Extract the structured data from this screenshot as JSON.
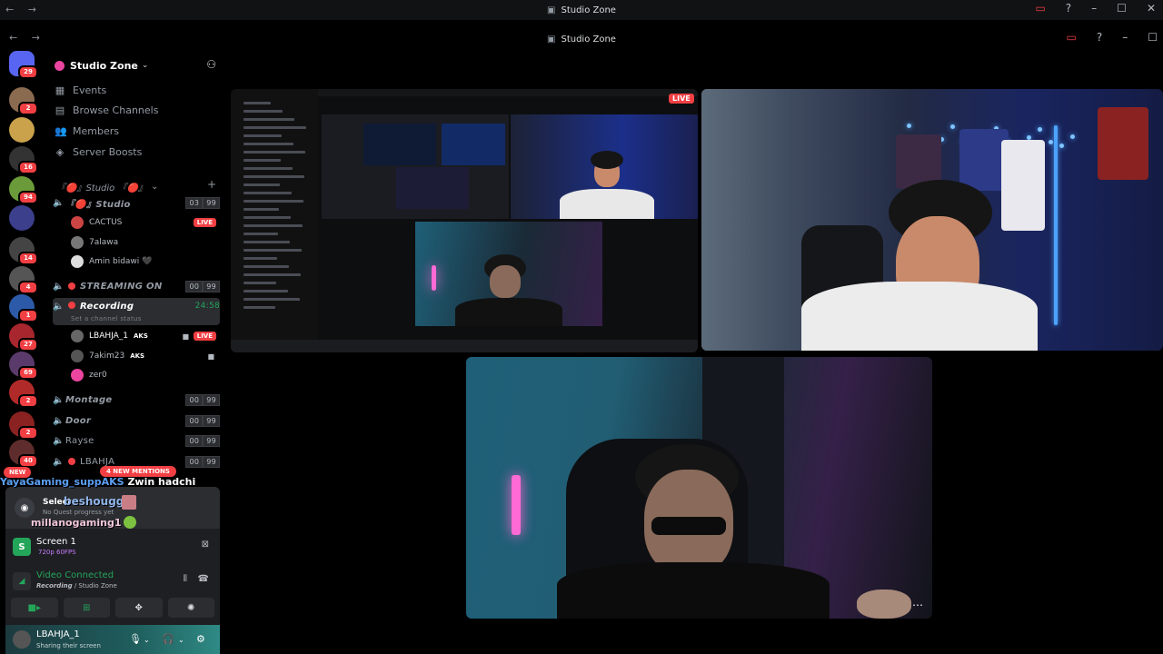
{
  "window": {
    "title": "Studio Zone",
    "inner_title": "Studio Zone"
  },
  "rail": {
    "servers": [
      {
        "name": "direct-messages",
        "badge": "29",
        "color": "#5865f2"
      },
      {
        "name": "server-1",
        "badge": "2",
        "color": "#8a6b4f"
      },
      {
        "name": "server-2",
        "badge": "",
        "color": "#c9a24b"
      },
      {
        "name": "server-3",
        "badge": "16",
        "color": "#333"
      },
      {
        "name": "server-4",
        "badge": "94",
        "color": "#6b9a3a"
      },
      {
        "name": "folder",
        "badge": "",
        "color": "#3b3f8c"
      },
      {
        "name": "server-6",
        "badge": "14",
        "color": "#444"
      },
      {
        "name": "server-7",
        "badge": "4",
        "color": "#555"
      },
      {
        "name": "server-8",
        "badge": "1",
        "color": "#2d5aa8"
      },
      {
        "name": "server-9",
        "badge": "27",
        "color": "#a8262e"
      },
      {
        "name": "server-10",
        "badge": "69",
        "color": "#5a3a6b"
      },
      {
        "name": "server-11",
        "badge": "2",
        "color": "#b12a2a"
      },
      {
        "name": "server-12",
        "badge": "2",
        "color": "#8a2222"
      },
      {
        "name": "server-13",
        "badge": "40",
        "color": "#5e2c2c"
      }
    ]
  },
  "sidebar": {
    "guild_name": "Studio Zone",
    "nav": [
      {
        "label": "Events",
        "icon": "calendar-icon"
      },
      {
        "label": "Browse Channels",
        "icon": "browse-icon"
      },
      {
        "label": "Members",
        "icon": "members-icon"
      },
      {
        "label": "Server Boosts",
        "icon": "boost-icon"
      }
    ],
    "category": "『🔴』Studio 『🔴』",
    "channels": {
      "studio": {
        "label": "『🔴』Studio",
        "c1": "03",
        "c2": "99"
      },
      "streaming": {
        "label": "STREAMING ON",
        "c1": "00",
        "c2": "99"
      },
      "recording": {
        "label": "Recording",
        "time": "24:58",
        "status": "Set a channel status"
      },
      "montage": {
        "label": "Montage",
        "c1": "00",
        "c2": "99"
      },
      "door": {
        "label": "Door",
        "c1": "00",
        "c2": "99"
      },
      "rayse": {
        "label": "Rayse",
        "c1": "00",
        "c2": "99"
      },
      "lbahja": {
        "label": "LBAHJA",
        "c1": "00",
        "c2": "99"
      }
    },
    "studio_users": [
      {
        "name": "CACTUS",
        "live": "LIVE",
        "color": "#c44"
      },
      {
        "name": "7alawa",
        "color": "#777"
      },
      {
        "name": "Amin bidawi 🖤",
        "color": "#ddd"
      }
    ],
    "recording_users": [
      {
        "name": "LBAHJA_1",
        "tag": "AKS",
        "live": "LIVE",
        "color": "#666"
      },
      {
        "name": "7akim23",
        "tag": "AKS",
        "color": "#555"
      },
      {
        "name": "zer0",
        "color": "#eb459f"
      }
    ],
    "new_pill": "NEW",
    "mentions_pill": "4 NEW MENTIONS"
  },
  "overlay_chat": {
    "line1_user": "YayaGaming_suppAKS",
    "line1_msg": "Zwin hadchi",
    "line2_user": "beshougg",
    "line3_user": "millanogaming1"
  },
  "panel": {
    "quest_title": "Select",
    "quest_sub": "No Quest progress yet",
    "screen_name": "Screen 1",
    "screen_quality": "720p 60FPS",
    "voice_status": "Video Connected",
    "voice_channel": "Recording",
    "voice_server": " / Studio Zone",
    "user_name": "LBAHJA_1",
    "user_status": "Sharing their screen"
  },
  "stage": {
    "live_label": "LIVE",
    "more_label": "⋯"
  }
}
